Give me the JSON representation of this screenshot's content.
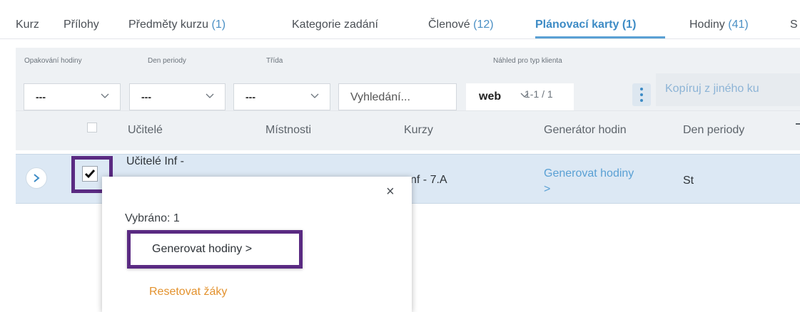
{
  "tabs": [
    {
      "label": "Kurz",
      "count": ""
    },
    {
      "label": "Přílohy",
      "count": ""
    },
    {
      "label": "Předměty kurzu ",
      "count": "(1)"
    },
    {
      "label": "Kategorie zadání",
      "count": ""
    },
    {
      "label": "Členové ",
      "count": "(12)"
    },
    {
      "label": "Plánovací karty ",
      "count": "(1)"
    },
    {
      "label": "Hodiny ",
      "count": "(41)"
    },
    {
      "label": "S",
      "count": ""
    }
  ],
  "filters": {
    "repeat_label": "Opakování hodiny",
    "repeat_value": "---",
    "day_label": "Den periody",
    "day_value": "---",
    "class_label": "Třída",
    "class_value": "---",
    "search_placeholder": "Vyhledání...",
    "client_label": "Náhled pro typ klienta",
    "client_value": "web",
    "pager": "1-1 / 1",
    "copy_button": "Kopíruj z jiného ku"
  },
  "table": {
    "headers": [
      "Učitelé",
      "Místnosti",
      "Kurzy",
      "Generátor hodin",
      "Den periody"
    ],
    "rows": [
      {
        "teachers": "Učitelé Inf -",
        "course": "nf - 7.A",
        "generator_line1": "Generovat hodiny",
        "generator_line2": ">",
        "day": "St"
      }
    ]
  },
  "popup": {
    "close": "×",
    "selected": "Vybráno: 1",
    "generate_button": "Generovat hodiny >",
    "reset_link": "Resetovat žáky"
  },
  "colors": {
    "accent": "#3d8bc5",
    "highlight": "#5a2a82",
    "warning": "#e3922e"
  }
}
